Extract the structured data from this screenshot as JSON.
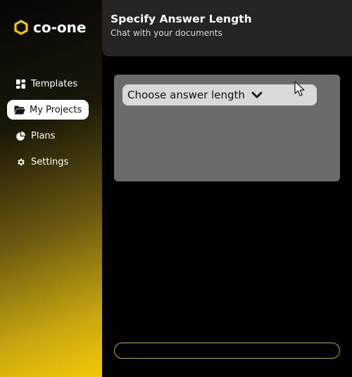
{
  "app": {
    "logo_text": "co-one",
    "brand_color": "#f3c807"
  },
  "sidebar": {
    "items": [
      {
        "label": "Templates",
        "icon": "grid-icon",
        "active": false
      },
      {
        "label": "My Projects",
        "icon": "folder-icon",
        "active": true
      },
      {
        "label": "Plans",
        "icon": "pie-chart-icon",
        "active": false
      },
      {
        "label": "Settings",
        "icon": "gear-icon",
        "active": false
      }
    ]
  },
  "header": {
    "title": "Specify Answer Length",
    "subtitle": "Chat with your documents"
  },
  "panel": {
    "dropdown": {
      "label": "Choose answer length",
      "icon": "chevron-down-icon"
    }
  },
  "chat": {
    "input_value": "",
    "placeholder": ""
  }
}
